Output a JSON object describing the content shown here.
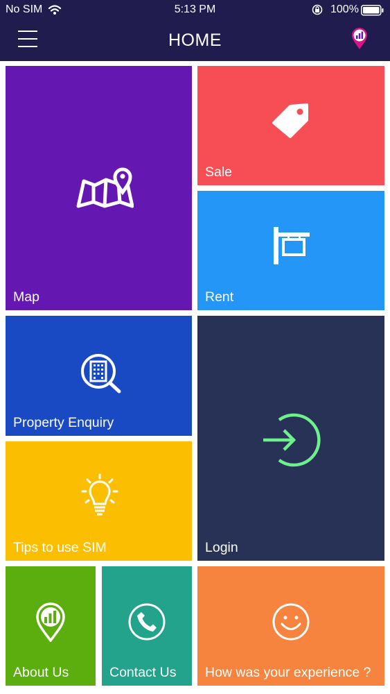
{
  "status_bar": {
    "carrier": "No SIM",
    "time": "5:13 PM",
    "battery": "100%"
  },
  "header": {
    "title": "HOME"
  },
  "tiles": {
    "map": {
      "label": "Map",
      "color": "#6417b1",
      "icon": "map-pin-icon"
    },
    "sale": {
      "label": "Sale",
      "color": "#f74e55",
      "icon": "price-tag-icon"
    },
    "rent": {
      "label": "Rent",
      "color": "#2396f7",
      "icon": "signpost-icon"
    },
    "property_enquiry": {
      "label": "Property Enquiry",
      "color": "#1a49c4",
      "icon": "building-search-icon"
    },
    "login": {
      "label": "Login",
      "color": "#283257",
      "icon": "login-icon",
      "accent": "#6ef08d"
    },
    "tips": {
      "label": "Tips to use SIM",
      "color": "#fcbe00",
      "icon": "lightbulb-icon"
    },
    "about_us": {
      "label": "About Us",
      "color": "#5bae0d",
      "icon": "location-chart-icon"
    },
    "contact_us": {
      "label": "Contact Us",
      "color": "#23a38b",
      "icon": "phone-icon"
    },
    "feedback": {
      "label": "How was your experience ?",
      "color": "#f7843e",
      "icon": "smiley-icon"
    }
  }
}
